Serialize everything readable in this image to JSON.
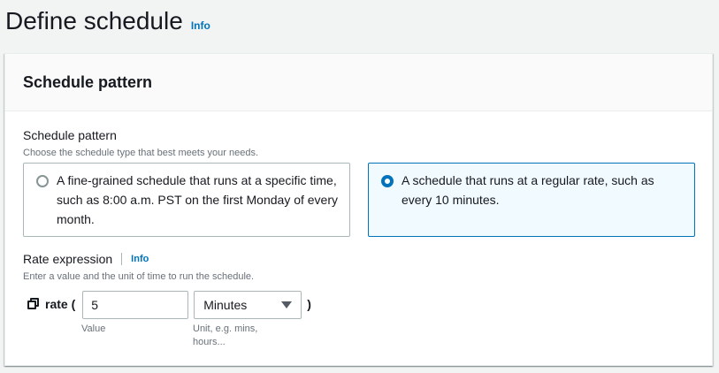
{
  "page": {
    "title": "Define schedule",
    "info_label": "Info"
  },
  "panel": {
    "title": "Schedule pattern"
  },
  "schedule_pattern": {
    "label": "Schedule pattern",
    "description": "Choose the schedule type that best meets your needs.",
    "options": [
      {
        "text": "A fine-grained schedule that runs at a specific time, such as 8:00 a.m. PST on the first Monday of every month.",
        "selected": false
      },
      {
        "text": "A schedule that runs at a regular rate, such as every 10 minutes.",
        "selected": true
      }
    ]
  },
  "rate_expression": {
    "label": "Rate expression",
    "info_label": "Info",
    "description": "Enter a value and the unit of time to run the schedule.",
    "prefix": "rate (",
    "suffix": ")",
    "value": "5",
    "value_hint": "Value",
    "unit_selected": "Minutes",
    "unit_hint": "Unit, e.g. mins, hours..."
  },
  "colors": {
    "accent": "#0073bb",
    "selected_bg": "#f1faff",
    "border": "#aab7b8",
    "muted_text": "#687078"
  },
  "icons": {
    "copy": "copy-icon",
    "dropdown": "caret-down-icon",
    "radio": "radio-button"
  }
}
